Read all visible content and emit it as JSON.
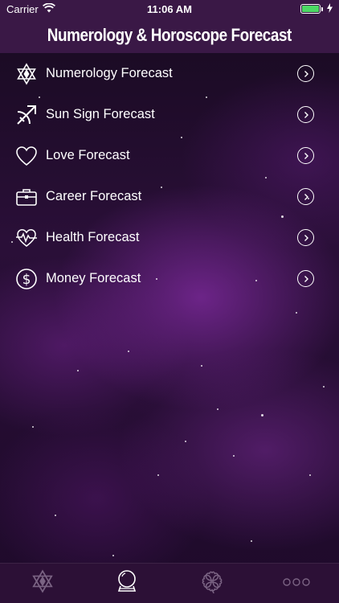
{
  "status_bar": {
    "carrier": "Carrier",
    "time": "11:06 AM",
    "battery_level": 1.0,
    "battery_color": "#4cd964"
  },
  "nav": {
    "title": "Numerology & Horoscope Forecast"
  },
  "menu": {
    "items": [
      {
        "label": "Numerology Forecast",
        "icon": "merkaba-star-icon"
      },
      {
        "label": "Sun Sign Forecast",
        "icon": "sagittarius-arrow-icon"
      },
      {
        "label": "Love Forecast",
        "icon": "heart-icon"
      },
      {
        "label": "Career Forecast",
        "icon": "briefcase-icon"
      },
      {
        "label": "Health Forecast",
        "icon": "heartbeat-icon"
      },
      {
        "label": "Money Forecast",
        "icon": "dollar-icon"
      }
    ]
  },
  "tabs": [
    {
      "icon": "merkaba-star-icon",
      "active": false
    },
    {
      "icon": "crystal-ball-icon",
      "active": true
    },
    {
      "icon": "four-leaf-clover-icon",
      "active": false
    },
    {
      "icon": "more-icon",
      "active": false
    }
  ],
  "colors": {
    "nav_background": "#3a1846",
    "tab_background": "#2c1036",
    "active_tab": "#ffffff",
    "inactive_tab": "#7a6383"
  }
}
